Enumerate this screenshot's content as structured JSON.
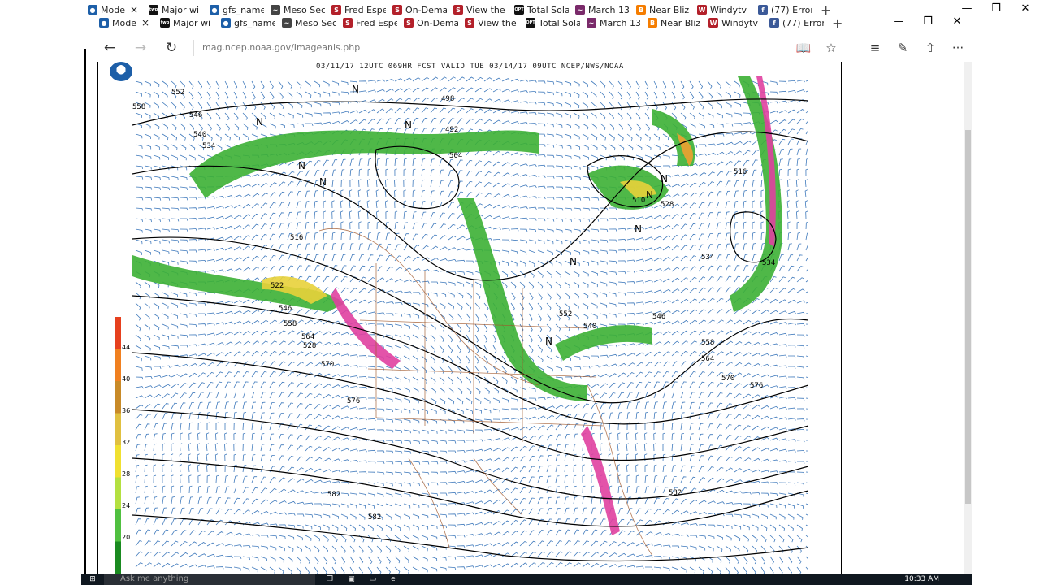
{
  "window_controls": {
    "minimize": "—",
    "restore": "❐",
    "close": "✕"
  },
  "tabs_back": [
    {
      "label": "Mode",
      "icon": "noaa-icon",
      "color": "#1d5fa8",
      "glyph": "●"
    },
    {
      "label": "Major wi",
      "icon": "twp-icon",
      "color": "#111111",
      "glyph": "twp"
    },
    {
      "label": "gfs_name",
      "icon": "noaa-icon",
      "color": "#1d5fa8",
      "glyph": "●"
    },
    {
      "label": "Meso Sec",
      "icon": "meso-icon",
      "color": "#444444",
      "glyph": "~"
    },
    {
      "label": "Fred Espe",
      "icon": "s-icon",
      "color": "#b3202a",
      "glyph": "S"
    },
    {
      "label": "On-Dema",
      "icon": "s-icon",
      "color": "#b3202a",
      "glyph": "S"
    },
    {
      "label": "View the",
      "icon": "s-icon",
      "color": "#b3202a",
      "glyph": "S"
    },
    {
      "label": "Total Sola",
      "icon": "opt-icon",
      "color": "#111111",
      "glyph": "OPT"
    },
    {
      "label": "March 13",
      "icon": "wave-icon",
      "color": "#7a2a6a",
      "glyph": "~"
    },
    {
      "label": "Near Bliz",
      "icon": "blogger-icon",
      "color": "#f57d00",
      "glyph": "B"
    },
    {
      "label": "Windytv",
      "icon": "windy-icon",
      "color": "#b3202a",
      "glyph": "W"
    },
    {
      "label": "(77) Error",
      "icon": "facebook-icon",
      "color": "#3b5998",
      "glyph": "f"
    }
  ],
  "tabs_front": [
    {
      "label": "Mode",
      "icon": "noaa-icon",
      "color": "#1d5fa8",
      "glyph": "●"
    },
    {
      "label": "Major wi",
      "icon": "twp-icon",
      "color": "#111111",
      "glyph": "twp"
    },
    {
      "label": "gfs_name",
      "icon": "noaa-icon",
      "color": "#1d5fa8",
      "glyph": "●"
    },
    {
      "label": "Meso Sec",
      "icon": "meso-icon",
      "color": "#444444",
      "glyph": "~"
    },
    {
      "label": "Fred Espe",
      "icon": "s-icon",
      "color": "#b3202a",
      "glyph": "S"
    },
    {
      "label": "On-Dema",
      "icon": "s-icon",
      "color": "#b3202a",
      "glyph": "S"
    },
    {
      "label": "View the",
      "icon": "s-icon",
      "color": "#b3202a",
      "glyph": "S"
    },
    {
      "label": "Total Sola",
      "icon": "opt-icon",
      "color": "#111111",
      "glyph": "OPT"
    },
    {
      "label": "March 13",
      "icon": "wave-icon",
      "color": "#7a2a6a",
      "glyph": "~"
    },
    {
      "label": "Near Bliz",
      "icon": "blogger-icon",
      "color": "#f57d00",
      "glyph": "B"
    },
    {
      "label": "Windytv",
      "icon": "windy-icon",
      "color": "#b3202a",
      "glyph": "W"
    },
    {
      "label": "(77) Error",
      "icon": "facebook-icon",
      "color": "#3b5998",
      "glyph": "f"
    }
  ],
  "new_tab": "+",
  "nav": {
    "back": "←",
    "forward": "→",
    "refresh": "↻"
  },
  "url": "mag.ncep.noaa.gov/Imageanis.php",
  "toolbar": {
    "reading": "📖",
    "favorite": "☆",
    "hub": "≡",
    "notes": "✎",
    "share": "⇧",
    "more": "···"
  },
  "map": {
    "title": "03/11/17 12UTC  069HR  FCST VALID TUE 03/14/17 09UTC  NCEP/NWS/NOAA",
    "colorbar_labels": [
      "44",
      "40",
      "36",
      "32",
      "28",
      "24",
      "20"
    ],
    "colorbar_colors": [
      "#e6401e",
      "#f08020",
      "#c88a28",
      "#e0c040",
      "#f0e030",
      "#b4e040",
      "#50c040",
      "#1a8a20"
    ],
    "contour_labels": [
      {
        "text": "552"
      },
      {
        "text": "558"
      },
      {
        "text": "546"
      },
      {
        "text": "540"
      },
      {
        "text": "534"
      },
      {
        "text": "528"
      },
      {
        "text": "516"
      },
      {
        "text": "522"
      },
      {
        "text": "498"
      },
      {
        "text": "492"
      },
      {
        "text": "504"
      },
      {
        "text": "510"
      },
      {
        "text": "516"
      },
      {
        "text": "528"
      },
      {
        "text": "534"
      },
      {
        "text": "546"
      },
      {
        "text": "558"
      },
      {
        "text": "564"
      },
      {
        "text": "570"
      },
      {
        "text": "576"
      },
      {
        "text": "582"
      },
      {
        "text": "582"
      },
      {
        "text": "582"
      },
      {
        "text": "534"
      },
      {
        "text": "540"
      },
      {
        "text": "552"
      },
      {
        "text": "558"
      },
      {
        "text": "564"
      },
      {
        "text": "570"
      },
      {
        "text": "576"
      },
      {
        "text": "546"
      }
    ],
    "low_markers": [
      "N",
      "N",
      "N",
      "N",
      "N",
      "N",
      "N",
      "N",
      "N",
      "N"
    ]
  },
  "taskbar": {
    "search": "Ask me anything",
    "time": "10:33 AM"
  }
}
